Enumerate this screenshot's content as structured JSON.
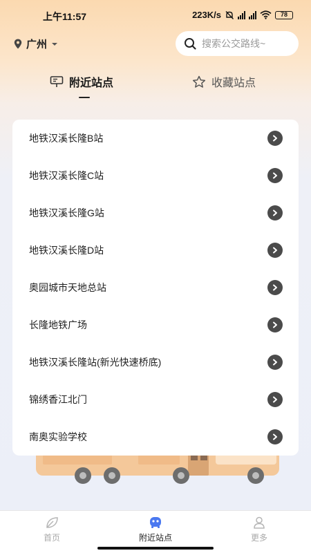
{
  "status_bar": {
    "time": "上午11:57",
    "network_speed": "223K/s",
    "battery": "78"
  },
  "header": {
    "city": "广州",
    "search_placeholder": "搜索公交路线~"
  },
  "tabs": [
    {
      "label": "附近站点",
      "icon": "bus-stop-sign-icon",
      "active": true
    },
    {
      "label": "收藏站点",
      "icon": "star-outline-icon",
      "active": false
    }
  ],
  "stations": [
    "地铁汉溪长隆B站",
    "地铁汉溪长隆C站",
    "地铁汉溪长隆G站",
    "地铁汉溪长隆D站",
    "奥园城市天地总站",
    "长隆地铁广场",
    "地铁汉溪长隆站(新光快速桥底)",
    "锦绣香江北门",
    "南奥实验学校"
  ],
  "bottom_nav": [
    {
      "label": "首页",
      "icon": "leaf-icon",
      "active": false
    },
    {
      "label": "附近站点",
      "icon": "bus-face-icon",
      "active": true
    },
    {
      "label": "更多",
      "icon": "person-icon",
      "active": false
    }
  ],
  "colors": {
    "header_gradient_top": "#fbd9b0",
    "background": "#eceff8",
    "arrow_bg": "#4b4b4b",
    "active_nav_icon": "#4a78f0"
  }
}
